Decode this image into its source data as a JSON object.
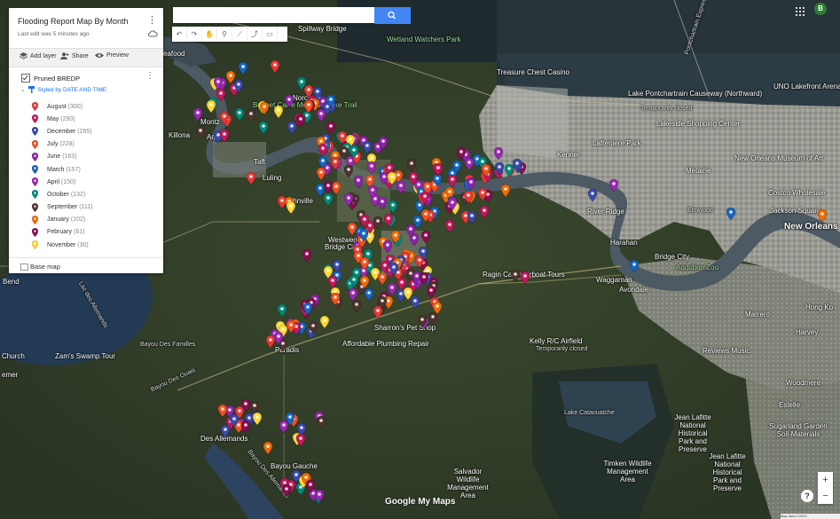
{
  "panel": {
    "title": "Flooding Report Map By Month",
    "subtitle": "Last edit was 5 minutes ago",
    "actions": {
      "add_layer": "Add layer",
      "share": "Share",
      "preview": "Preview"
    },
    "layer_name": "Pruned BREDP",
    "style_label": "Styled by DATE AND TIME",
    "legend": [
      {
        "month": "August",
        "count": "(300)",
        "color": "#e53935"
      },
      {
        "month": "May",
        "count": "(290)",
        "color": "#c2185b"
      },
      {
        "month": "December",
        "count": "(265)",
        "color": "#3949ab"
      },
      {
        "month": "July",
        "count": "(228)",
        "color": "#f4511e"
      },
      {
        "month": "June",
        "count": "(163)",
        "color": "#8e24aa"
      },
      {
        "month": "March",
        "count": "(157)",
        "color": "#1565c0"
      },
      {
        "month": "April",
        "count": "(150)",
        "color": "#9c27b0"
      },
      {
        "month": "October",
        "count": "(132)",
        "color": "#00897b"
      },
      {
        "month": "September",
        "count": "(111)",
        "color": "#4e342e"
      },
      {
        "month": "January",
        "count": "(102)",
        "color": "#ef6c00"
      },
      {
        "month": "February",
        "count": "(61)",
        "color": "#880e4f"
      },
      {
        "month": "November",
        "count": "(30)",
        "color": "#fdd835"
      }
    ],
    "base_map": "Base map"
  },
  "search": {
    "placeholder": ""
  },
  "avatar": {
    "initial": "B"
  },
  "map": {
    "labels": [
      {
        "text": "Spillway Bridge"
      },
      {
        "text": "Wetland Watchers Park"
      },
      {
        "text": "Treasure Chest Casino"
      },
      {
        "text": "Pontchartrain Expressway"
      },
      {
        "text": "Lake Pontchartrain Causeway (Northward)"
      },
      {
        "text": "Temporarily closed"
      },
      {
        "text": "UNO Lakefront Arena"
      },
      {
        "text": "Lakeside Shopping Center"
      },
      {
        "text": "Lafreniere Park"
      },
      {
        "text": "Kenner"
      },
      {
        "text": "Metairie"
      },
      {
        "text": "New Orleans Museum of Art"
      },
      {
        "text": "Costco Wholesale"
      },
      {
        "text": "River Ridge"
      },
      {
        "text": "Harahan"
      },
      {
        "text": "Elmwood"
      },
      {
        "text": "Jackson Square"
      },
      {
        "text": "New Orleans"
      },
      {
        "text": "Bridge City"
      },
      {
        "text": "Audubon Zoo"
      },
      {
        "text": "Waggaman"
      },
      {
        "text": "Avondale"
      },
      {
        "text": "Ragin Cajun Airboat Tours"
      },
      {
        "text": "Marrero"
      },
      {
        "text": "Hong Ko"
      },
      {
        "text": "Kelly R/C Airfield"
      },
      {
        "text": "Temporarily closed"
      },
      {
        "text": "Reviews Music"
      },
      {
        "text": "Sharron's Pet Shop"
      },
      {
        "text": "Affordable Plumbing Repair"
      },
      {
        "text": "Zam's Swamp Tour"
      },
      {
        "text": "Bayou Des Familles"
      },
      {
        "text": "Des Allemands"
      },
      {
        "text": "Paradis"
      },
      {
        "text": "Bayou Gauche"
      },
      {
        "text": "Lake Cataouatche"
      },
      {
        "text": "Jean Lafitte National Historical Park and Preserve"
      },
      {
        "text": "Jean Lafitte National Historical Park and Preserve"
      },
      {
        "text": "Sugarland Garden Soil-Materials"
      },
      {
        "text": "Salvador Wildlife Management Area"
      },
      {
        "text": "Timken Wildlife Management Area"
      },
      {
        "text": "Estelle"
      },
      {
        "text": "Woodmere"
      },
      {
        "text": "Montz"
      },
      {
        "text": "Norco"
      },
      {
        "text": "Bonnet Carre Mountain Bike Trail"
      },
      {
        "text": "Westwego"
      },
      {
        "text": "Bridge City"
      },
      {
        "text": "Harvey"
      },
      {
        "text": "Bend"
      },
      {
        "text": "Church"
      },
      {
        "text": "emer"
      },
      {
        "text": "Lac des Allemands"
      },
      {
        "text": "Bayou Des Ouais"
      },
      {
        "text": "Bayou Des Allemands"
      },
      {
        "text": "Luling"
      },
      {
        "text": "Hahnville"
      },
      {
        "text": "Killona"
      },
      {
        "text": "Ama"
      },
      {
        "text": "eafood"
      },
      {
        "text": "Taft"
      }
    ]
  },
  "branding": "Google My Maps",
  "footer": "Map data ©2023"
}
